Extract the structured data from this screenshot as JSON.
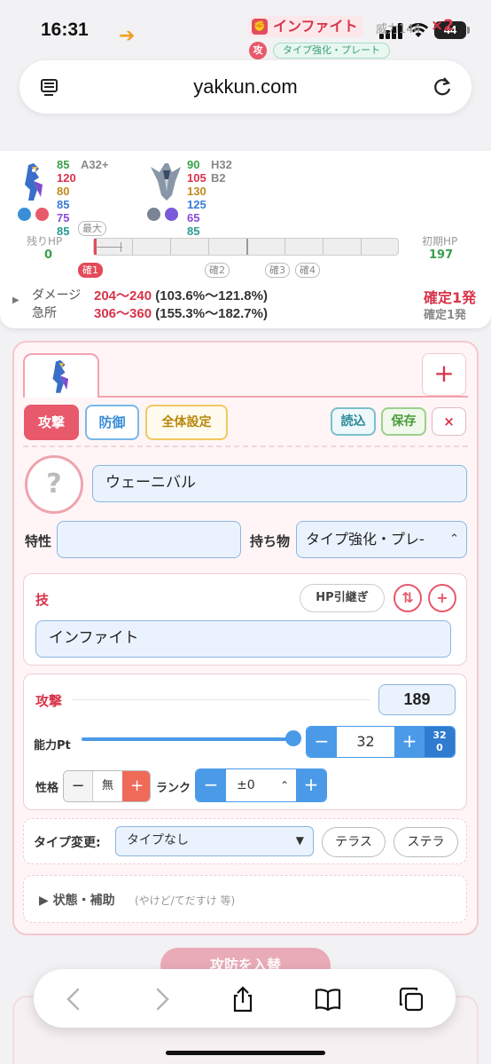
{
  "status": {
    "time": "16:31",
    "battery": "44"
  },
  "browser": {
    "url": "yakkun.com"
  },
  "summary": {
    "attacker": {
      "stats": [
        "85",
        "120",
        "80",
        "85",
        "75",
        "85"
      ],
      "level": "A32+"
    },
    "defender": {
      "stats": [
        "90",
        "105",
        "130",
        "125",
        "65",
        "85"
      ],
      "level1": "H32",
      "level2": "B2"
    },
    "move": "インファイト",
    "power": "威力144",
    "times": "×2",
    "atk_badge": "攻",
    "item": "タイプ強化・プレート",
    "hp_left_label": "残りHP",
    "hp_left_value": "0",
    "hp_right_label": "初期HP",
    "hp_right_value": "197",
    "tags": {
      "max": "最大",
      "ko1": "確1",
      "ko2": "確2",
      "ko3": "確3",
      "ko4": "確4"
    },
    "damage_label": "ダメージ",
    "damage_range": "204〜240",
    "damage_pct": "(103.6%〜121.8%)",
    "crit_label": "急所",
    "crit_range": "306〜360",
    "crit_pct": "(155.3%〜182.7%)",
    "result": "確定1発",
    "crit_result": "確定1発"
  },
  "panel": {
    "plus": "+",
    "tabs": {
      "attack": "攻撃",
      "defense": "防御",
      "all": "全体設定"
    },
    "actions": {
      "load": "読込",
      "save": "保存",
      "close": "×"
    },
    "question": "?",
    "name": "ウェーニバル",
    "ability_label": "特性",
    "ability_value": "",
    "item_label": "持ち物",
    "item_value": "タイプ強化・プレ-",
    "move_section": "技",
    "hp_carry": "HP引継ぎ",
    "move_value": "インファイト",
    "stat_section": "攻撃",
    "stat_value": "189",
    "ev_label": "能力Pt",
    "ev_value": "32",
    "ev_mini_top": "32",
    "ev_mini_bottom": "0",
    "nature_label": "性格",
    "nature_value": "無",
    "rank_label": "ランク",
    "rank_value": "±0",
    "type_change_label": "タイプ変更:",
    "type_change_value": "タイプなし",
    "tera": "テラス",
    "stellar": "ステラ",
    "state_label": "▶ 状態・補助",
    "state_sub": "(やけど/てだすけ 等)"
  },
  "swap_button": "攻防を入替",
  "colors": {
    "accent": "#e8596b",
    "blue": "#4a9ae8",
    "green": "#3aa04a"
  }
}
